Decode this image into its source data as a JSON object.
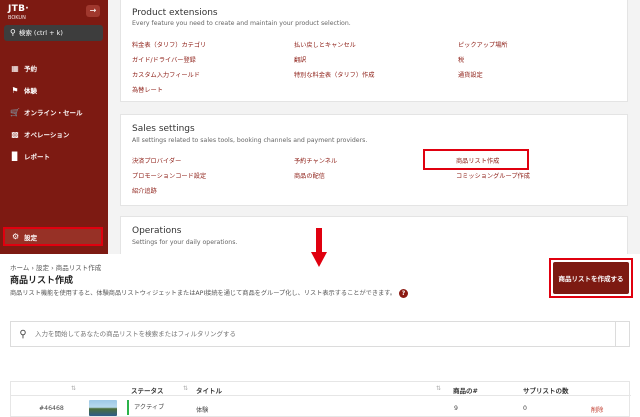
{
  "sidebar": {
    "brand_main": "JTB·",
    "brand_sub": "BOKUN",
    "collapse_icon": "arrow-right-icon",
    "search_label": "検索 (ctrl + k)",
    "items": [
      {
        "label": "予約",
        "icon": "calendar-icon"
      },
      {
        "label": "体験",
        "icon": "flag-icon"
      },
      {
        "label": "オンライン・セール",
        "icon": "cart-icon"
      },
      {
        "label": "オペレーション",
        "icon": "clipboard-icon"
      },
      {
        "label": "レポート",
        "icon": "bar-chart-icon"
      }
    ],
    "settings_label": "設定"
  },
  "product_extensions": {
    "title": "Product extensions",
    "description": "Every feature you need to create and maintain your product selection.",
    "links": [
      "料金表（タリフ）カテゴリ",
      "払い戻しとキャンセル",
      "ピックアップ場所",
      "ガイド/ドライバー登録",
      "翻訳",
      "税",
      "カスタム入力フィールド",
      "特別な料金表（タリフ）作成",
      "通貨設定",
      "為替レート"
    ]
  },
  "sales_settings": {
    "title": "Sales settings",
    "description": "All settings related to sales tools, booking channels and payment providers.",
    "links": [
      "決済プロバイダー",
      "予約チャンネル",
      "商品リスト作成",
      "プロモーションコード設定",
      "商品の配信",
      "コミッショングループ作成",
      "紹介追跡"
    ]
  },
  "operations": {
    "title": "Operations",
    "description": "Settings for your daily operations."
  },
  "product_list_page": {
    "breadcrumb": "ホーム › 設定 › 商品リスト作成",
    "title": "商品リスト作成",
    "description": "商品リスト機能を使用すると、体験商品リストウィジェットまたはAPI接続を通じて商品をグループ化し、リスト表示することができます。",
    "help_icon": "?",
    "create_button": "商品リストを作成する",
    "search_placeholder": "入力を開始してあなたの商品リストを検索またはフィルタリングする",
    "table": {
      "columns": [
        "ステータス",
        "タイトル",
        "商品の#",
        "サブリストの数"
      ],
      "rows": [
        {
          "id": "#46468",
          "status": "アクティブ",
          "title": "体験",
          "product_count": "9",
          "sublist_count": "0",
          "delete": "削除"
        }
      ]
    }
  },
  "colors": {
    "sidebar": "#7d1a12",
    "accent": "#8b1a12",
    "highlight": "#e0000f",
    "active_status": "#2bb34a"
  }
}
